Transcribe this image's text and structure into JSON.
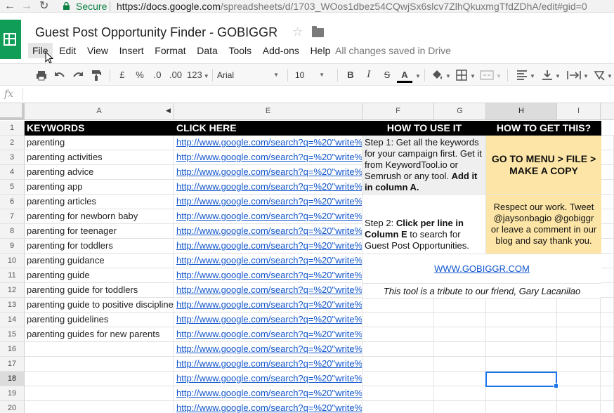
{
  "browser": {
    "back": "←",
    "forward": "→",
    "reload": "↻",
    "secure_label": "Secure",
    "url_main": "https://docs.google.com",
    "url_rest": "/spreadsheets/d/1703_WOos1dbez54CQwjSx6slcv7ZlhQkuxmgTfdZDhA/edit#gid=0"
  },
  "doc": {
    "title": "Guest Post Opportunity Finder - GOBIGGR"
  },
  "menu": {
    "items": [
      "File",
      "Edit",
      "View",
      "Insert",
      "Format",
      "Data",
      "Tools",
      "Add-ons",
      "Help"
    ],
    "saved_status": "All changes saved in Drive"
  },
  "toolbar": {
    "currency": "£",
    "percent": "%",
    "dec_less": ".0",
    "dec_more": ".00",
    "more_formats": "123",
    "font": "Arial",
    "font_size": "10",
    "bold": "B",
    "italic": "I",
    "strike": "S",
    "text_color": "A"
  },
  "formula_bar": {
    "fx": "fx"
  },
  "columns": {
    "A": "A",
    "E": "E",
    "F": "F",
    "G": "G",
    "H": "H",
    "I": "I"
  },
  "row_numbers": [
    "1",
    "2",
    "3",
    "4",
    "5",
    "6",
    "7",
    "8",
    "9",
    "10",
    "11",
    "12",
    "13",
    "14",
    "15",
    "16",
    "17",
    "18",
    "19",
    "20"
  ],
  "sheet": {
    "header_keywords": "KEYWORDS",
    "header_click": "CLICK HERE",
    "header_how_use": "HOW TO USE IT",
    "header_how_get": "HOW TO GET THIS?",
    "keywords": [
      "parenting",
      "parenting activities",
      "parenting advice",
      "parenting app",
      "parenting articles",
      "parenting for newborn baby",
      "parenting for teenager",
      "parenting for toddlers",
      "parenting guidance",
      "parenting guide",
      "parenting guide for toddlers",
      "parenting guide to positive discipline",
      "parenting guidelines",
      "parenting guides for new parents"
    ],
    "link_text": "http://www.google.com/search?q=%20\"write%",
    "step1_prefix": "Step 1: Get all the keywords for your campaign first. Get it from KeywordTool.io or Semrush or any tool. ",
    "step1_bold": "Add it in column A.",
    "step2_prefix": "Step 2: ",
    "step2_bold": "Click per line in Column E",
    "step2_suffix": " to search for Guest Post Opportunities.",
    "copy_instruction": "GO TO MENU > FILE > MAKE A COPY",
    "respect_text": "Respect our work. Tweet @jaysonbagio @gobiggr or leave a comment in our blog and say thank you.",
    "site_link": "WWW.GOBIGGR.COM",
    "tribute": "This tool is a tribute to our friend, Gary Lacanilao"
  },
  "colors": {
    "sheets_green": "#0f9d58",
    "header_black": "#000000",
    "highlight_yellow": "#fce5a6",
    "step_grey": "#efefef",
    "link_blue": "#1155cc",
    "selection_blue": "#1a73e8"
  },
  "icons": [
    "back-icon",
    "forward-icon",
    "reload-icon",
    "lock-icon",
    "star-icon",
    "folder-icon",
    "print-icon",
    "undo-icon",
    "redo-icon",
    "paint-format-icon",
    "fill-color-icon",
    "borders-icon",
    "merge-icon",
    "align-left-icon",
    "valign-bottom-icon",
    "text-wrap-icon",
    "text-rotate-icon"
  ]
}
